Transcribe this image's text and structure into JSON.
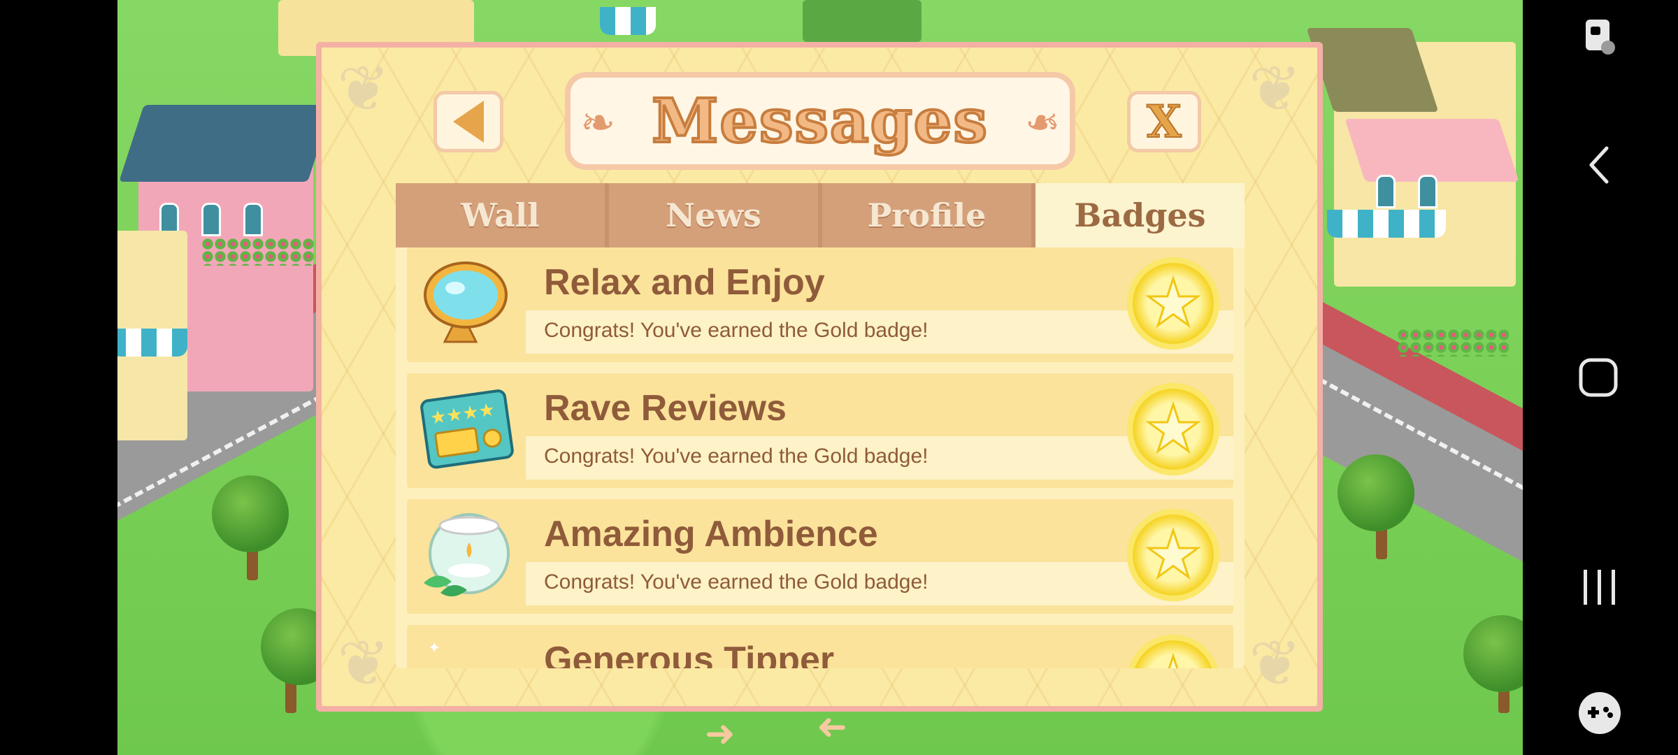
{
  "dialog": {
    "title": "Messages",
    "close_label": "X"
  },
  "tabs": [
    {
      "label": "Wall",
      "active": false
    },
    {
      "label": "News",
      "active": false
    },
    {
      "label": "Profile",
      "active": false
    },
    {
      "label": "Badges",
      "active": true
    }
  ],
  "badges": [
    {
      "name": "Relax and Enjoy",
      "desc": "Congrats! You've earned the Gold badge!",
      "icon": "mirror-icon",
      "level_icon": "gold-star-badge-icon"
    },
    {
      "name": "Rave Reviews",
      "desc": "Congrats! You've earned the Gold badge!",
      "icon": "review-card-icon",
      "level_icon": "gold-star-badge-icon"
    },
    {
      "name": "Amazing Ambience",
      "desc": "Congrats! You've earned the Gold badge!",
      "icon": "candle-bowl-icon",
      "level_icon": "gold-star-badge-icon"
    },
    {
      "name": "Generous Tipper",
      "desc": "",
      "icon": "tip-icon",
      "level_icon": "gold-star-badge-icon"
    }
  ],
  "nav": {
    "icons": [
      "screen-lock-icon",
      "back-arrow-icon",
      "home-icon",
      "recent-apps-icon",
      "game-controller-icon"
    ]
  },
  "colors": {
    "dialog_bg": "#fbeaa4",
    "dialog_border": "#f4b0a5",
    "tab_inactive": "#d4a07a",
    "tab_active": "#fcf3cf",
    "text_brown": "#8f5b3a",
    "badge_gold": "#f6d52a"
  }
}
